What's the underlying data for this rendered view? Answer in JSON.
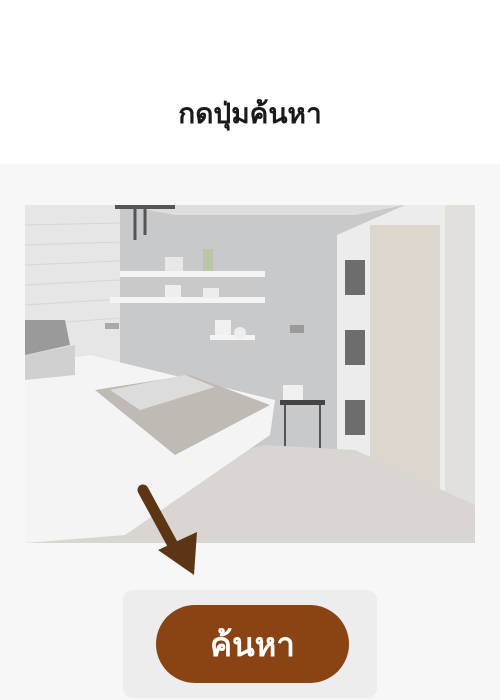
{
  "instruction": {
    "title": "กดปุ่มค้นหา"
  },
  "photo": {
    "alt": "bedroom"
  },
  "search_button": {
    "label": "ค้นหา"
  },
  "colors": {
    "button": "#8a4413",
    "arrow": "#5b3514",
    "background": "#f7f7f7"
  }
}
